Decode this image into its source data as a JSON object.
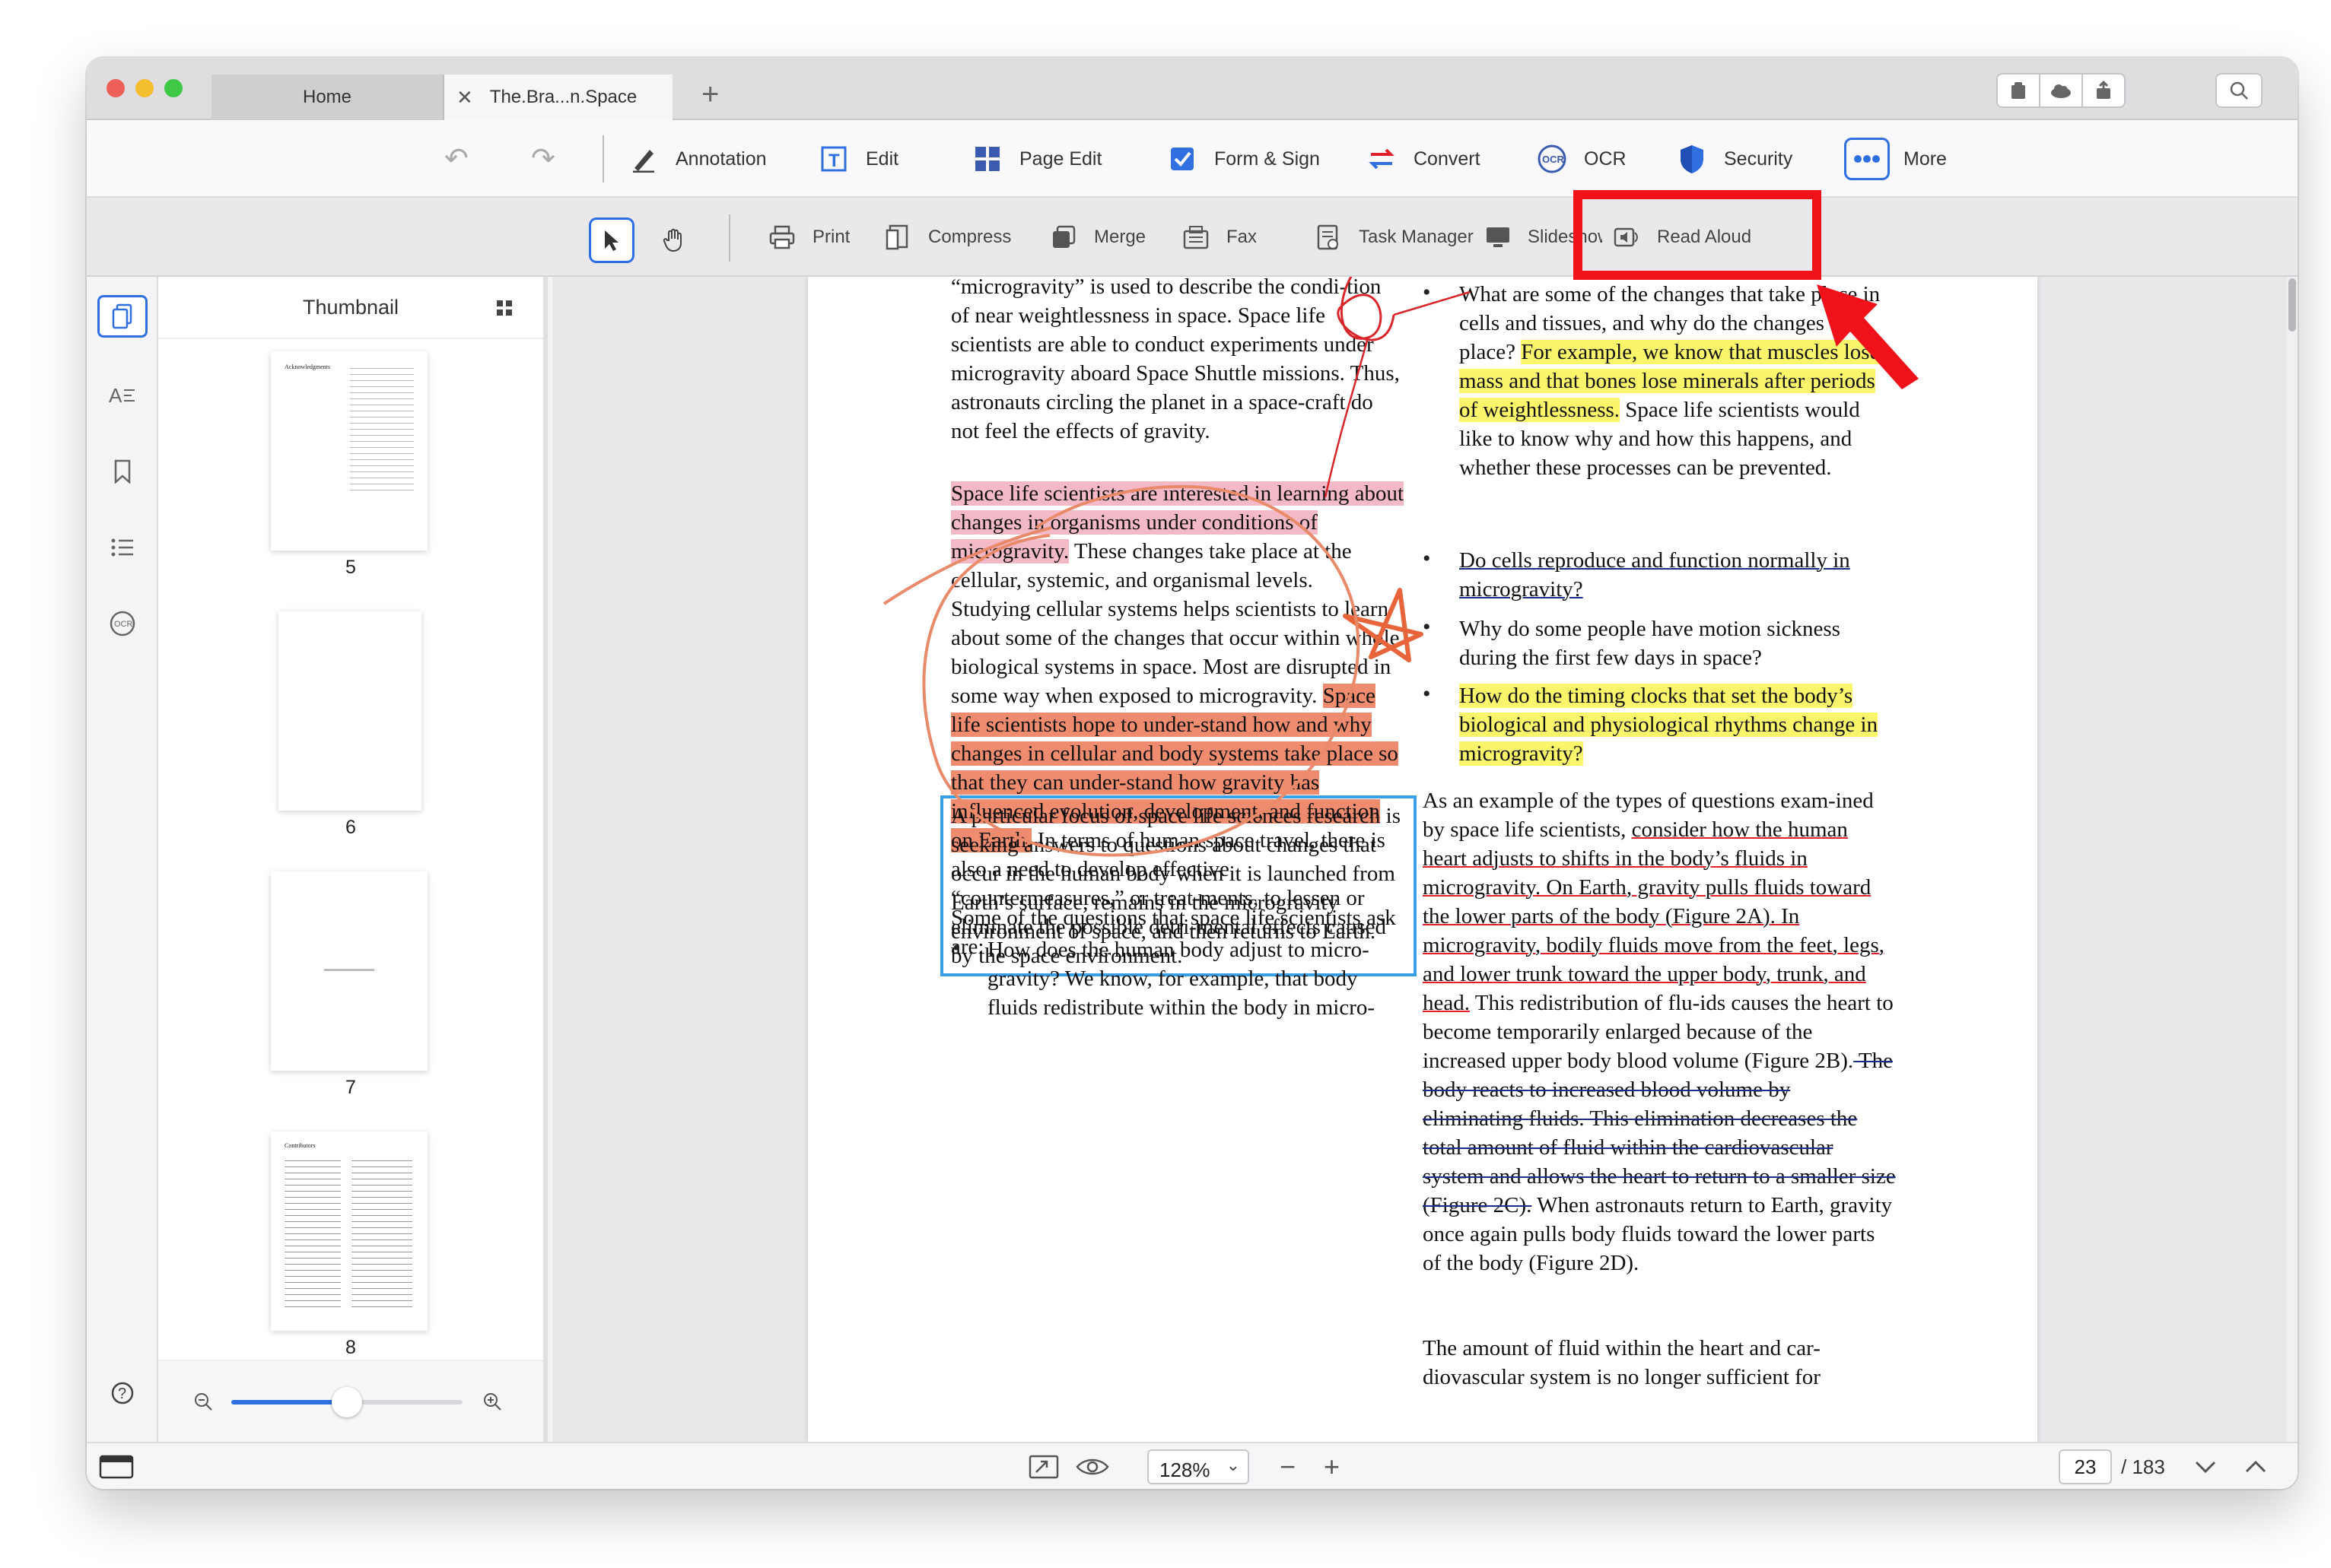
{
  "window": {
    "tabs": [
      {
        "label": "Home"
      },
      {
        "label": "The.Bra...n.Space"
      }
    ],
    "new_tab_label": "+"
  },
  "main_toolbar": {
    "items": [
      {
        "label": "Annotation",
        "icon": "annotation-pen-icon"
      },
      {
        "label": "Edit",
        "icon": "edit-text-icon"
      },
      {
        "label": "Page Edit",
        "icon": "page-grid-icon"
      },
      {
        "label": "Form & Sign",
        "icon": "checkbox-icon"
      },
      {
        "label": "Convert",
        "icon": "convert-arrows-icon"
      },
      {
        "label": "OCR",
        "icon": "ocr-icon"
      },
      {
        "label": "Security",
        "icon": "shield-icon"
      },
      {
        "label": "More",
        "icon": "more-dots-icon"
      }
    ]
  },
  "sub_toolbar": {
    "items": [
      {
        "label": "Print",
        "icon": "printer-icon"
      },
      {
        "label": "Compress",
        "icon": "compress-icon"
      },
      {
        "label": "Merge",
        "icon": "merge-icon"
      },
      {
        "label": "Fax",
        "icon": "fax-icon"
      },
      {
        "label": "Task Manager",
        "icon": "task-manager-icon"
      },
      {
        "label": "Slideshow",
        "icon": "monitor-icon"
      },
      {
        "label": "Read Aloud",
        "icon": "read-aloud-icon"
      }
    ]
  },
  "thumbnail_panel": {
    "title": "Thumbnail",
    "pages": [
      {
        "number": "5",
        "heading": "Acknowledgments"
      },
      {
        "number": "6"
      },
      {
        "number": "7"
      },
      {
        "number": "8",
        "heading": "Contributors"
      }
    ]
  },
  "document": {
    "left_column": {
      "p1": "“microgravity” is used to describe the condi-tion of near weightlessness in space. Space life scientists are able to conduct experiments under microgravity aboard Space Shuttle missions. Thus, astronauts circling the planet in a space-craft do not feel the effects of gravity.",
      "p2_highlight": "Space life scientists are interested in learning about changes in organisms under conditions of microgravity.",
      "p2_rest": " These changes take place at the cellular, systemic, and organismal levels.",
      "p3_start": "Studying cellular systems helps scientists to learn about some of the changes that occur within whole biological systems in space. Most are disrupted in some way when exposed to microgravity. ",
      "p3_highlight": "Space life scientists hope to under-stand how and why changes in cellular and body systems take place so that they can under-stand how gravity has influenced evolution, development, and function on Earth.",
      "p3_end": " In terms of human space travel, there is also a need to develop effective “countermeasures,” or treat-ments, to lessen or eliminate the possible detri-mental effects caused by the space environment.",
      "p4_boxed": "A particular focus of space life sciences research is seeking answers to questions about changes that occur in the human body when it is launched from Earth’s surface, remains in the microgravity environment of space, and then returns to Earth.",
      "p5": "Some of the questions that space life scientists ask are:",
      "bullet1": "How does the human body adjust to micro-gravity? We know, for example, that body fluids redistribute within the body in micro-"
    },
    "right_column": {
      "b1_start": "What are some of the changes that take place in cells and tissues, and why do the changes take place? ",
      "b1_highlight": "For example, we know that muscles lose mass and that bones lose minerals after periods of weightlessness.",
      "b1_end": " Space life scientists would like to know why and how this happens, and whether these processes can be prevented.",
      "b2_underlined": "Do cells reproduce and function normally in microgravity?",
      "b3": "Why do some people have motion sickness during the first few days in space?",
      "b4_highlight": "How do the timing clocks that set the body’s biological and physiological rhythms change in microgravity?",
      "p6_start": "As an example of the types of questions exam-ined by space life scientists, ",
      "p6_underlined": "consider how the human heart adjusts to shifts in the body’s fluids in microgravity. On Earth, gravity pulls fluids toward the lower parts of the body (Figure 2A). In microgravity, bodily fluids move from the feet, legs, and lower trunk toward the upper body, trunk, and head.",
      "p6_mid": " This redistribution of flu-ids causes the heart to become temporarily enlarged because of the increased upper body blood volume (Figure 2B).",
      "p6_struck": " The body reacts to increased blood volume by eliminating fluids. This elimination decreases the total amount of fluid within the cardiovascular system and allows the heart to return to a smaller size (Figure 2C).",
      "p6_end": " When astronauts return to Earth, gravity once again pulls body fluids toward the lower parts of the body (Figure 2D).",
      "p7": "The amount of fluid within the heart and car-diovascular system is no longer sufficient for"
    }
  },
  "status_bar": {
    "zoom": "128%",
    "zoom_minus": "−",
    "zoom_plus": "+",
    "current_page": "23",
    "total_pages": "/ 183"
  },
  "colors": {
    "callout_red": "#f0111a",
    "accent_blue": "#2f6fe0",
    "highlight_yellow": "#fbf56b",
    "highlight_pink": "#f3b9c7",
    "highlight_salmon": "#ef8c6f",
    "box_blue": "#3aa0e6"
  }
}
